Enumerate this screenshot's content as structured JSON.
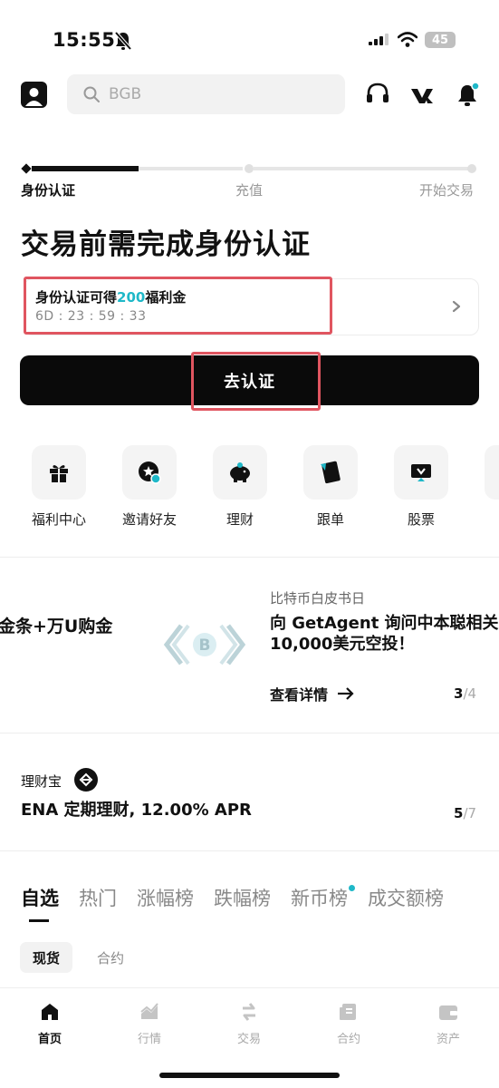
{
  "status_bar": {
    "time": "15:55",
    "battery": "45"
  },
  "search": {
    "placeholder": "BGB"
  },
  "progress": {
    "steps": [
      "身份认证",
      "充值",
      "开始交易"
    ],
    "active_index": 0
  },
  "title": "交易前需完成身份认证",
  "bonus": {
    "prefix": "身份认证可得",
    "amount": "200",
    "suffix": "福利金",
    "countdown": "6D : 23 : 59 : 33"
  },
  "verify_button": "去认证",
  "shortcuts": [
    "福利中心",
    "邀请好友",
    "理财",
    "跟单",
    "股票"
  ],
  "banner": {
    "left_text": "金条+万U购金",
    "subtitle": "比特币白皮书日",
    "title_line1": "向 GetAgent 询问中本聪相关问",
    "title_line2": "10,000美元空投！",
    "link": "查看详情",
    "page_current": "3",
    "page_total": "/4"
  },
  "earn": {
    "label": "理财宝",
    "title": "ENA 定期理财, 12.00% APR",
    "page_current": "5",
    "page_total": "/7"
  },
  "market_tabs": [
    "自选",
    "热门",
    "涨幅榜",
    "跌幅榜",
    "新币榜",
    "成交额榜"
  ],
  "sub_tabs": [
    "现货",
    "合约"
  ],
  "bottom_nav": [
    "首页",
    "行情",
    "交易",
    "合约",
    "资产"
  ],
  "colors": {
    "accent": "#1fb8c8",
    "highlight_box": "#e05560",
    "primary": "#0a0a0a"
  }
}
